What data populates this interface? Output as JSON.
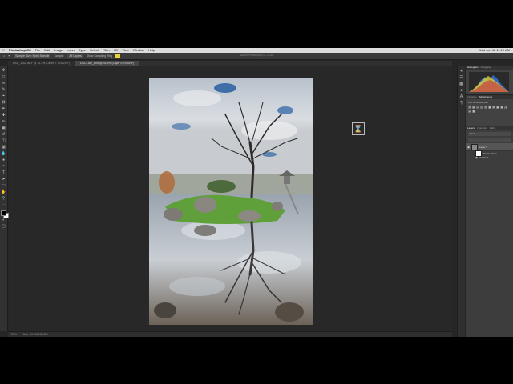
{
  "menubar": {
    "app_name": "Photoshop CC",
    "items": [
      "File",
      "Edit",
      "Image",
      "Layer",
      "Type",
      "Select",
      "Filter",
      "3D",
      "View",
      "Window",
      "Help"
    ],
    "clock": "Wed Jun 18 11:12 AM"
  },
  "window_title": "Adobe Photoshop CC 2018",
  "options_bar": {
    "sample": "Sample Size: Point Sample",
    "sample_label": "Sample:",
    "sample_value": "All Layers",
    "grid_label": "Show Sampling Ring"
  },
  "tabs": [
    {
      "label": "DSC_1162.NEF @ 33.3% (Layer 0, RGB/16*)",
      "active": false
    },
    {
      "label": "DSC1162_Arch@ 33.3% (Layer 0, RGB/8*)",
      "active": true
    }
  ],
  "status": {
    "zoom": "25%",
    "doc_size": "Doc: 69.1M/138.2M"
  },
  "right_panels": {
    "histogram_tabs": [
      "Histogram",
      "Navigator"
    ],
    "adjust_tabs": [
      "Libraries",
      "Adjustments"
    ],
    "adjust_title": "Add an adjustment",
    "layers_tabs": [
      "Layers",
      "Channels",
      "Paths"
    ],
    "kind_label": "Kind",
    "layer_name": "Layer 0",
    "sub_mask_label": "Smart Filters",
    "sub_filter_label": "Oil Paint"
  },
  "colors": {
    "accent_swatch": "#e6d23c",
    "app_bg": "#262626",
    "panel_bg": "#424242"
  }
}
